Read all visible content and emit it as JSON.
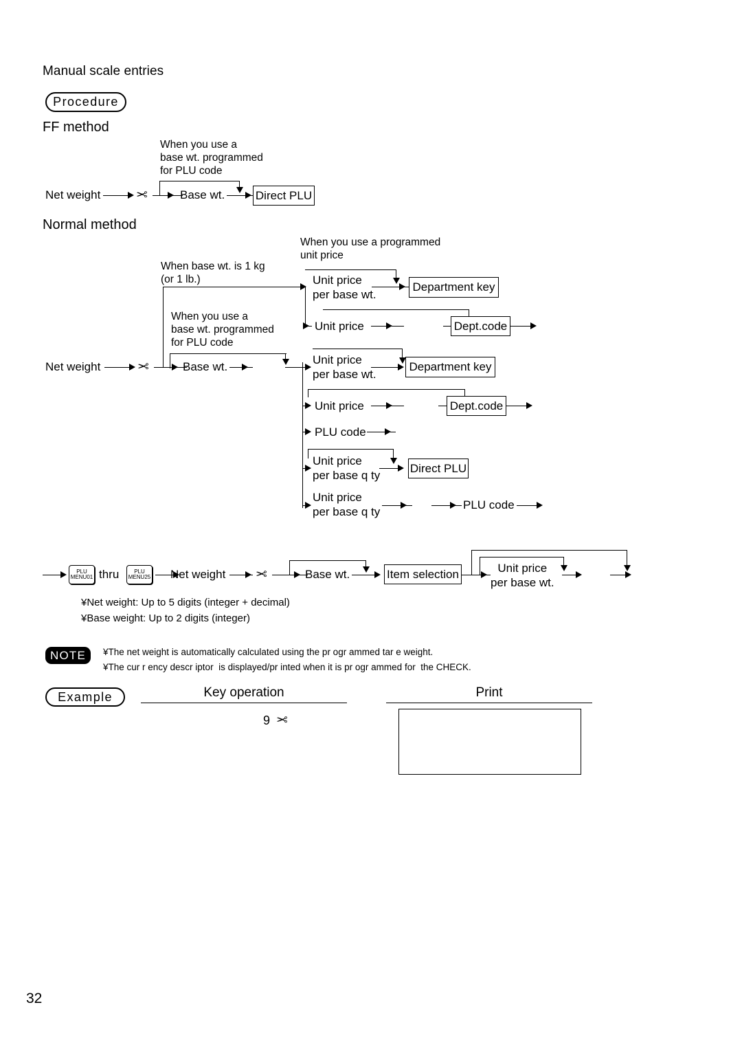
{
  "page": {
    "number": "32",
    "title": "Manual scale entries"
  },
  "procedure": {
    "badge": "Procedure",
    "ff_method": {
      "heading": "FF method",
      "note_label": "When you use a\nbase wt. programmed\nfor PLU code",
      "start_label": "Net weight",
      "scissors_icon": "scissors-icon",
      "base_label": "Base wt.",
      "terminal_box": "Direct PLU"
    },
    "normal_method": {
      "heading": "Normal method",
      "label_base_1kg": "When base wt. is 1 kg\n(or 1 lb.)",
      "label_programmed_unit_price": "When you use a programmed\nunit price",
      "label_base_wt_plu": "When you use a\nbase wt. programmed\nfor PLU code",
      "start_label": "Net weight",
      "scissors_icon": "scissors-icon",
      "base_label": "Base wt.",
      "branches": [
        {
          "id": "b1",
          "node": "Unit price\nper base wt.",
          "target": "Department key",
          "target_is_box": true
        },
        {
          "id": "b2",
          "node": "Unit price",
          "target": "Dept.code",
          "target_is_box": true
        },
        {
          "id": "b3",
          "node": "Unit price\nper base wt.",
          "target": "Department key",
          "target_is_box": true
        },
        {
          "id": "b4",
          "node": "Unit price",
          "target": "Dept.code",
          "target_is_box": true
        },
        {
          "id": "b5",
          "node": "PLU code",
          "target": "",
          "target_is_box": false
        },
        {
          "id": "b6",
          "node": "Unit price\nper base q ty",
          "target": "Direct PLU",
          "target_is_box": true
        },
        {
          "id": "b7",
          "node": "Unit price\nper base q ty",
          "target": "PLU code",
          "target_is_box": false
        }
      ]
    },
    "menu_flow": {
      "key_first_line1": "PLU",
      "key_first_line2": "MENU01",
      "thru_label": "thru",
      "key_last_line1": "PLU",
      "key_last_line2": "MENU25",
      "net_weight_label": "Net weight",
      "scissors_icon": "scissors-icon",
      "base_label": "Base wt.",
      "item_selection_box": "Item selection",
      "unit_price_label": "Unit price\nper base wt."
    },
    "digit_notes": [
      "¥Net weight: Up to 5 digits (integer + decimal)",
      "¥Base weight: Up to 2 digits (integer)"
    ]
  },
  "note": {
    "badge": "NOTE",
    "lines": [
      "¥The net weight is automatically calculated using the pr ogr ammed tar e weight.",
      "¥The cur r ency descr iptor  is displayed/pr inted when it is pr ogr ammed for  the CHECK."
    ]
  },
  "example": {
    "badge": "Example",
    "key_operation_caption": "Key operation",
    "print_caption": "Print",
    "key_operation_value": "9",
    "key_operation_icon": "scissors-icon",
    "print_receipt_content": ""
  }
}
